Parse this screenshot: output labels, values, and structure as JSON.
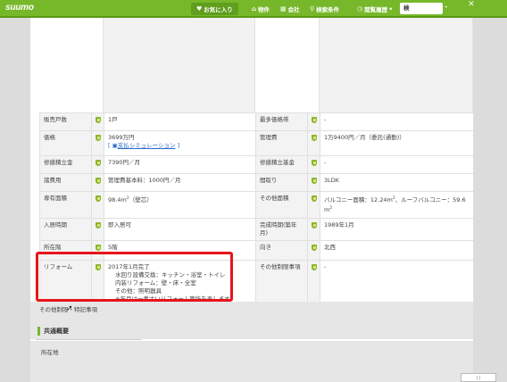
{
  "header": {
    "logo": "suumo",
    "favorites": "お気に入り",
    "bukken": "物件",
    "company": "会社",
    "search_conditions": "検索条件",
    "history": "閲覧履歴",
    "history_caret": "▾",
    "search_button": "検",
    "close": "✕"
  },
  "table": {
    "rows": [
      {
        "l_label": "販売戸数",
        "l_value": "1戸",
        "r_label": "最多価格帯",
        "r_value": "-"
      },
      {
        "l_label": "価格",
        "l_value": "3699万円",
        "l_link_bracket_open": "[ ",
        "l_link": "支払シミュレーション",
        "l_link_bracket_close": " ]",
        "r_label": "管理費",
        "r_value": "1万9400円／月（委託(通勤)）"
      },
      {
        "l_label": "修繕積立金",
        "l_value": "7390円／月",
        "r_label": "修繕積立基金",
        "r_value": "-"
      },
      {
        "l_label": "諸費用",
        "l_value": "管理費基本料：1000円／月",
        "r_label": "間取り",
        "r_value": "3LDK"
      },
      {
        "l_label": "専有面積",
        "l_value": "98.4m",
        "l_sup": "2",
        "l_value_suffix": "（壁芯）",
        "r_label": "その他面積",
        "r_value": "バルコニー面積：12.24m",
        "r_sup": "2",
        "r_value_suffix": "、ルーフバルコニー：59.6",
        "r_value_line2": "m",
        "r_sup2": "2"
      },
      {
        "l_label": "入居時期",
        "l_value": "即入居可",
        "r_label": "完成時期(築年月)",
        "r_value": "1989年1月"
      },
      {
        "l_label": "所在階",
        "l_value": "5階",
        "r_label": "向き",
        "r_value": "北西"
      },
      {
        "l_label": "リフォーム",
        "l_lines": [
          "2017年1月完了",
          "水回り設備交換：キッチン・浴室・トイレ",
          "内装リフォーム：壁・床・全室",
          "その他：照明器具",
          "※年月は一番古いリフォーム箇所を表します"
        ],
        "r_label": "その他制限事項",
        "r_value": "-"
      }
    ]
  },
  "other_label": "その他制限・特記事項",
  "common": {
    "title": "共通概要",
    "location_label": "所在地"
  },
  "badge": "[ ]",
  "colors": {
    "brand_green": "#76b82a",
    "highlight_red": "#e8141b",
    "link_blue": "#2a6bc9"
  }
}
